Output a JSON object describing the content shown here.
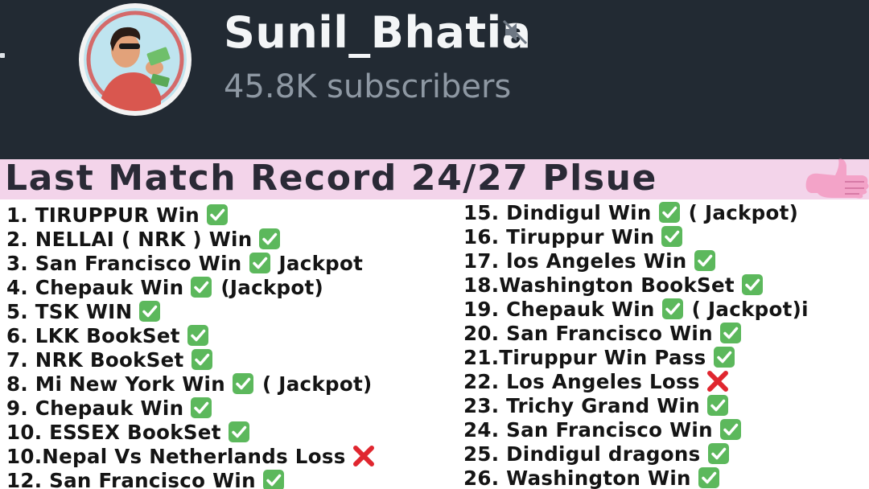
{
  "channel": {
    "name": "Sunil_Bhatia",
    "subscribers": "45.8K subscribers",
    "muted": true
  },
  "banner": {
    "title": "Last Match Record 24/27 Plsue"
  },
  "colors": {
    "header_bg": "#222a33",
    "banner_bg": "#f3d4ea",
    "check_green": "#5cb85c",
    "cross_red": "#e0262f"
  },
  "records_left": [
    {
      "text": "1. TIRUPPUR Win",
      "mark": "check-icon",
      "note": ""
    },
    {
      "text": "2. NELLAI ( NRK ) Win",
      "mark": "check-icon",
      "note": ""
    },
    {
      "text": "3. San Francisco Win",
      "mark": "check-icon",
      "note": "Jackpot"
    },
    {
      "text": "4. Chepauk Win",
      "mark": "check-icon",
      "note": "(Jackpot)"
    },
    {
      "text": "5. TSK WIN",
      "mark": "check-icon",
      "note": ""
    },
    {
      "text": "6. LKK BookSet",
      "mark": "check-icon",
      "note": ""
    },
    {
      "text": "7. NRK BookSet",
      "mark": "check-icon",
      "note": ""
    },
    {
      "text": "8. Mi New York Win",
      "mark": "check-icon",
      "note": "( Jackpot)"
    },
    {
      "text": "9. Chepauk Win",
      "mark": "check-icon",
      "note": ""
    },
    {
      "text": "10. ESSEX BookSet",
      "mark": "check-icon",
      "note": ""
    },
    {
      "text": "10.Nepal Vs Netherlands Loss",
      "mark": "cross-icon",
      "note": ""
    },
    {
      "text": "12. San Francisco Win",
      "mark": "check-icon",
      "note": ""
    }
  ],
  "records_right": [
    {
      "text": "15. Dindigul Win",
      "mark": "check-icon",
      "note": "( Jackpot)"
    },
    {
      "text": "16. Tiruppur Win",
      "mark": "check-icon",
      "note": ""
    },
    {
      "text": "17. los Angeles Win",
      "mark": "check-icon",
      "note": ""
    },
    {
      "text": "18.Washington BookSet",
      "mark": "check-icon",
      "note": ""
    },
    {
      "text": "19. Chepauk Win",
      "mark": "check-icon",
      "note": "( Jackpot)i"
    },
    {
      "text": "20. San Francisco Win",
      "mark": "check-icon",
      "note": ""
    },
    {
      "text": "21.Tiruppur Win Pass",
      "mark": "check-icon",
      "note": ""
    },
    {
      "text": "22. Los Angeles Loss",
      "mark": "cross-icon",
      "note": ""
    },
    {
      "text": "23. Trichy Grand Win",
      "mark": "check-icon",
      "note": ""
    },
    {
      "text": "24. San Francisco Win",
      "mark": "check-icon",
      "note": ""
    },
    {
      "text": "25. Dindigul dragons",
      "mark": "check-icon",
      "note": ""
    },
    {
      "text": "26. Washington Win",
      "mark": "check-icon",
      "note": ""
    }
  ]
}
